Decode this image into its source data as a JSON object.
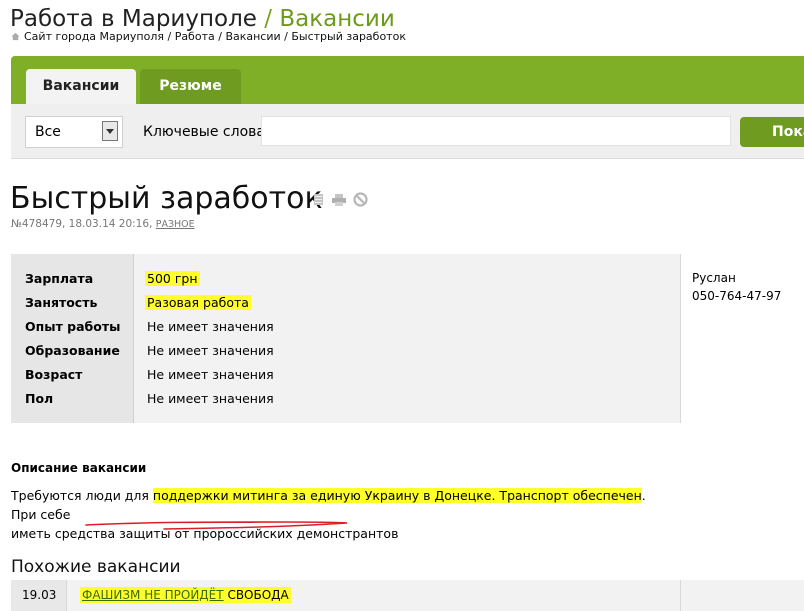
{
  "header": {
    "site_title": "Работа в Мариуполе",
    "separator": "/",
    "section": "Вакансии",
    "breadcrumbs": [
      "Сайт города Мариуполя",
      "Работа",
      "Вакансии",
      "Быстрый заработок"
    ]
  },
  "search": {
    "tabs": [
      {
        "label": "Вакансии",
        "active": true
      },
      {
        "label": "Резюме",
        "active": false
      }
    ],
    "category_selected": "Все",
    "keywords_label": "Ключевые слова",
    "keywords_value": "",
    "submit_label": "Показать"
  },
  "job": {
    "title": "Быстрый заработок",
    "meta": "№478479, 18.03.14 20:16,",
    "category": "РАЗНОЕ",
    "details": [
      {
        "label": "Зарплата",
        "value": "500 грн",
        "highlight": true
      },
      {
        "label": "Занятость",
        "value": "Разовая работа",
        "highlight": true
      },
      {
        "label": "Опыт работы",
        "value": "Не имеет значения",
        "highlight": false
      },
      {
        "label": "Образование",
        "value": "Не имеет значения",
        "highlight": false
      },
      {
        "label": "Возраст",
        "value": "Не имеет значения",
        "highlight": false
      },
      {
        "label": "Пол",
        "value": "Не имеет значения",
        "highlight": false
      }
    ],
    "contact_name": "Руслан",
    "contact_phone": "050-764-47-97",
    "description_heading": "Описание вакансии",
    "description": {
      "part1": "Требуются люди для ",
      "part2_highlight": "поддержки митинга за единую Украину в Донецке. Транспорт обеспечен",
      "part3": ". При себе",
      "part4": "иметь средства защиты от пророссийских демонстрантов"
    }
  },
  "similar": {
    "heading": "Похожие вакансии",
    "items": [
      {
        "date": "19.03",
        "link": "ФАШИЗМ НЕ ПРОЙДЁТ",
        "extra": "СВОБОДА"
      }
    ]
  },
  "colors": {
    "brand_green": "#7fae27",
    "highlight": "#ffff2a",
    "annotation_red": "#d9202a"
  }
}
